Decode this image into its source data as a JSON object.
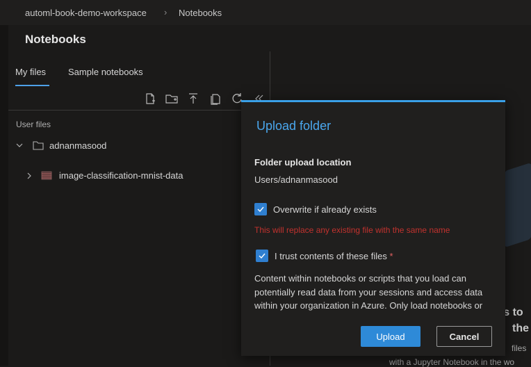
{
  "breadcrumb": {
    "workspace": "automl-book-demo-workspace",
    "page": "Notebooks"
  },
  "panel": {
    "title": "Notebooks",
    "tabs": [
      {
        "label": "My files"
      },
      {
        "label": "Sample notebooks"
      }
    ],
    "section_label": "User files",
    "tree": {
      "root": "adnanmasood",
      "child": "image-classification-mnist-data"
    }
  },
  "background": {
    "text_line1": "rs to",
    "text_line2": "the",
    "small_line1": "files",
    "small_line2": "with a Jupyter Notebook in the wo"
  },
  "modal": {
    "title": "Upload folder",
    "location_label": "Folder upload location",
    "location_value": "Users/adnanmasood",
    "overwrite_label": "Overwrite if already exists",
    "overwrite_checked": true,
    "warning": "This will replace any existing file with the same name",
    "trust_label": "I trust contents of these files",
    "trust_required_mark": "*",
    "trust_checked": true,
    "description": "Content within notebooks or scripts that you load can potentially read data from your sessions and access data within your organization in Azure. Only load notebooks or scripts into Azure from trusted sources.",
    "upload_button": "Upload",
    "cancel_button": "Cancel"
  },
  "colors": {
    "accent": "#2e8ad8",
    "title_blue": "#4aa7ee",
    "warning": "#c2322e"
  }
}
